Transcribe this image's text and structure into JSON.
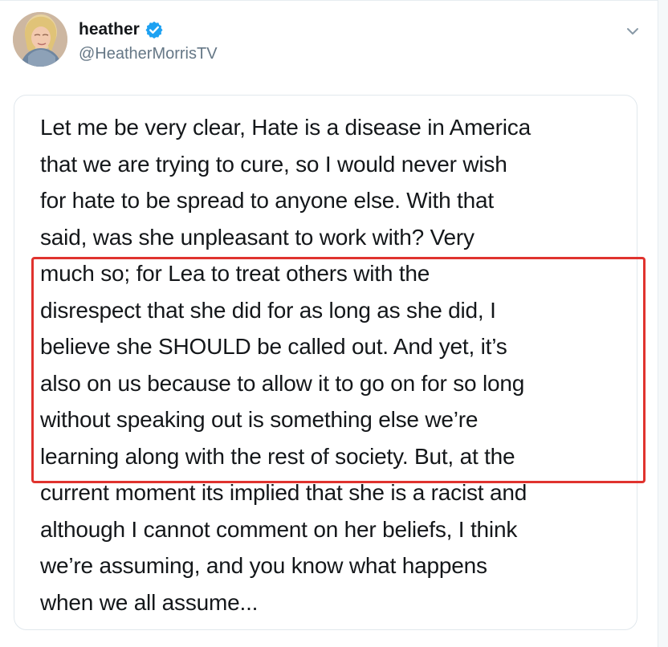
{
  "user": {
    "display_name": "heather",
    "handle": "@HeatherMorrisTV",
    "verified": true,
    "avatar": "profile-photo",
    "verified_icon": "verified-badge-icon",
    "menu_icon": "chevron-down-icon"
  },
  "tweet": {
    "lines": [
      "Let me be very clear, Hate is a disease in America",
      "that we are trying to cure, so I would never wish",
      "for hate to be spread to anyone else. With that",
      "said, was she unpleasant to work with? Very",
      "much so; for Lea to treat others with the",
      "disrespect that she did for as long as she did, I",
      "believe she SHOULD be called out. And yet, it’s",
      "also on us because to allow it to go on for so long",
      "without speaking out is something else we’re",
      "learning along with the rest of society. But, at the",
      "current moment its implied that she is a racist and",
      "although I cannot comment on her beliefs, I think",
      "we’re assuming, and you know what happens",
      "when we all assume..."
    ]
  },
  "annotation": {
    "color": "#e0332e",
    "highlighted_line_indices": [
      4,
      5,
      6,
      7,
      8,
      9
    ]
  },
  "colors": {
    "text": "#14171a",
    "muted": "#657786",
    "border": "#e1e8ed",
    "verified": "#1da1f2"
  }
}
